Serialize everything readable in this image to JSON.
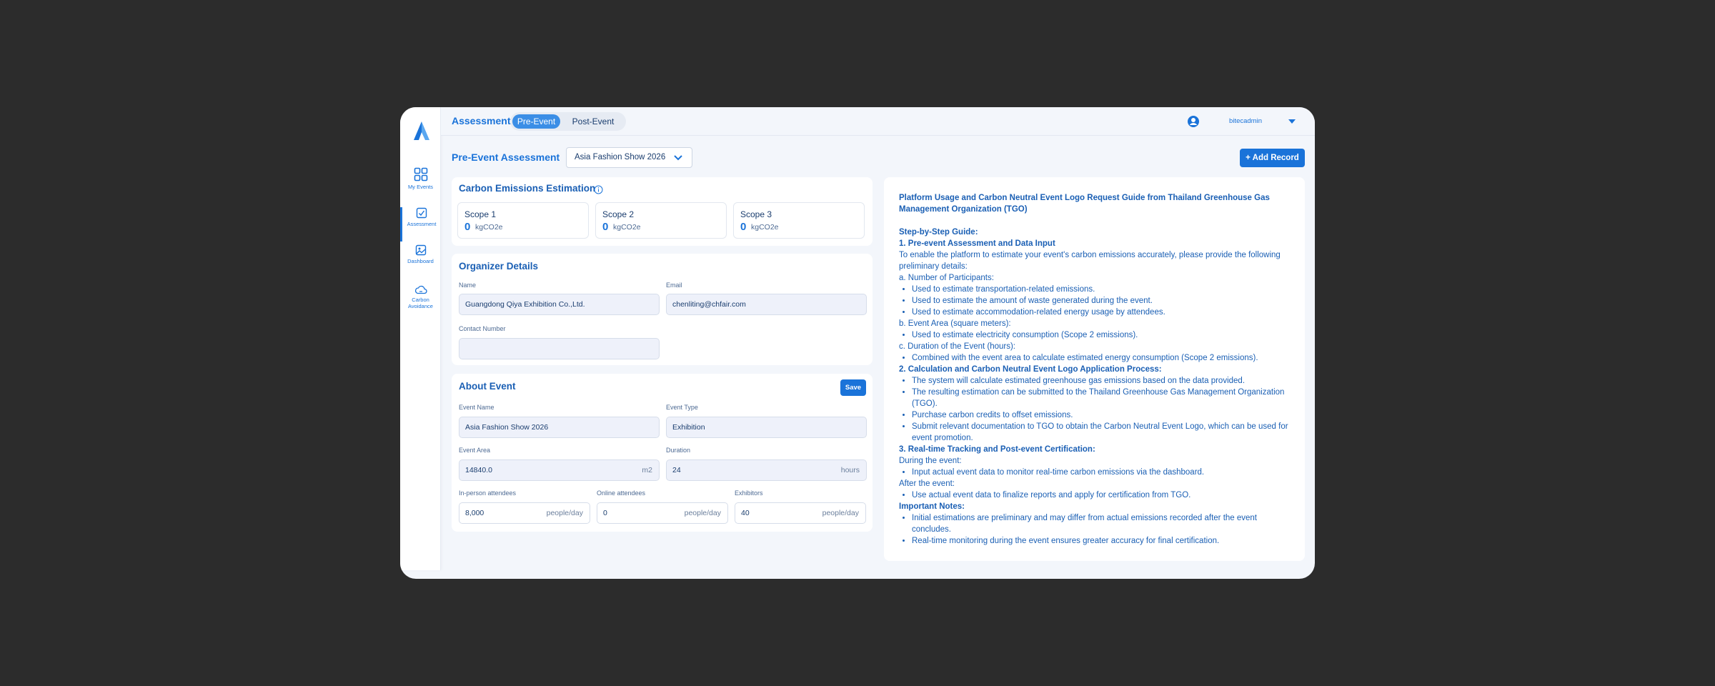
{
  "topbar": {
    "title": "Assessment",
    "tabs": [
      "Pre-Event",
      "Post-Event"
    ],
    "active_tab": "Pre-Event",
    "username": "bitecadmin"
  },
  "sidebar": {
    "items": [
      {
        "label": "My Events",
        "icon": "grid-icon"
      },
      {
        "label": "Assessment",
        "icon": "checkbox-icon",
        "active": true
      },
      {
        "label": "Dashboard",
        "icon": "image-icon"
      },
      {
        "label": "Carbon Avoidance",
        "icon": "cloud-icon"
      }
    ]
  },
  "header": {
    "page_title": "Pre-Event Assessment",
    "event_select": "Asia Fashion Show 2026",
    "add_record": "+ Add Record"
  },
  "emissions": {
    "title": "Carbon Emissions Estimation",
    "scopes": [
      {
        "label": "Scope 1",
        "value": "0",
        "unit": "kgCO2e"
      },
      {
        "label": "Scope 2",
        "value": "0",
        "unit": "kgCO2e"
      },
      {
        "label": "Scope 3",
        "value": "0",
        "unit": "kgCO2e"
      }
    ]
  },
  "organizer": {
    "title": "Organizer Details",
    "name_label": "Name",
    "name_value": "Guangdong Qiya Exhibition Co.,Ltd.",
    "email_label": "Email",
    "email_value": "chenliting@chfair.com",
    "contact_label": "Contact Number",
    "contact_value": ""
  },
  "about": {
    "title": "About Event",
    "save": "Save",
    "event_name_label": "Event Name",
    "event_name_value": "Asia Fashion Show 2026",
    "event_type_label": "Event Type",
    "event_type_value": "Exhibition",
    "area_label": "Event Area",
    "area_value": "14840.0",
    "area_unit": "m2",
    "duration_label": "Duration",
    "duration_value": "24",
    "duration_unit": "hours",
    "inperson_label": "In-person attendees",
    "inperson_value": "8,000",
    "online_label": "Online attendees",
    "online_value": "0",
    "exhibitors_label": "Exhibitors",
    "exhibitors_value": "40",
    "per_day_unit": "people/day"
  },
  "guide": {
    "title": "Platform Usage and Carbon Neutral Event Logo Request Guide from Thailand Greenhouse Gas Management Organization (TGO)",
    "step_heading": "Step-by-Step Guide:",
    "s1_heading": "1. Pre-event Assessment and Data Input",
    "s1_intro": "To enable the platform to estimate your event's carbon emissions accurately, please provide the following preliminary details:",
    "s1_a": "a. Number of Participants:",
    "s1_a_items": [
      "Used to estimate transportation-related emissions.",
      "Used to estimate the amount of waste generated during the event.",
      "Used to estimate accommodation-related energy usage by attendees."
    ],
    "s1_b": "b. Event Area (square meters):",
    "s1_b_items": [
      "Used to estimate electricity consumption (Scope 2 emissions)."
    ],
    "s1_c": "c. Duration of the Event (hours):",
    "s1_c_items": [
      "Combined with the event area to calculate estimated energy consumption (Scope 2 emissions)."
    ],
    "s2_heading": "2. Calculation and Carbon Neutral Event Logo Application Process:",
    "s2_items": [
      "The system will calculate estimated greenhouse gas emissions based on the data provided.",
      "The resulting estimation can be submitted to the Thailand Greenhouse Gas Management Organization (TGO).",
      "Purchase carbon credits to offset emissions.",
      "Submit relevant documentation to TGO to obtain the Carbon Neutral Event Logo, which can be used for event promotion."
    ],
    "s3_heading": "3. Real-time Tracking and Post-event Certification:",
    "s3_during": "During the event:",
    "s3_during_items": [
      "Input actual event data to monitor real-time carbon emissions via the dashboard."
    ],
    "s3_after": "After the event:",
    "s3_after_items": [
      "Use actual event data to finalize reports and apply for certification from TGO."
    ],
    "notes_heading": "Important Notes:",
    "notes_items": [
      "Initial estimations are preliminary and may differ from actual emissions recorded after the event concludes.",
      "Real-time monitoring during the event ensures greater accuracy for final certification."
    ]
  },
  "colors": {
    "accent": "#1a73d9",
    "background": "#2c2c2c",
    "window": "#f3f6fb"
  }
}
